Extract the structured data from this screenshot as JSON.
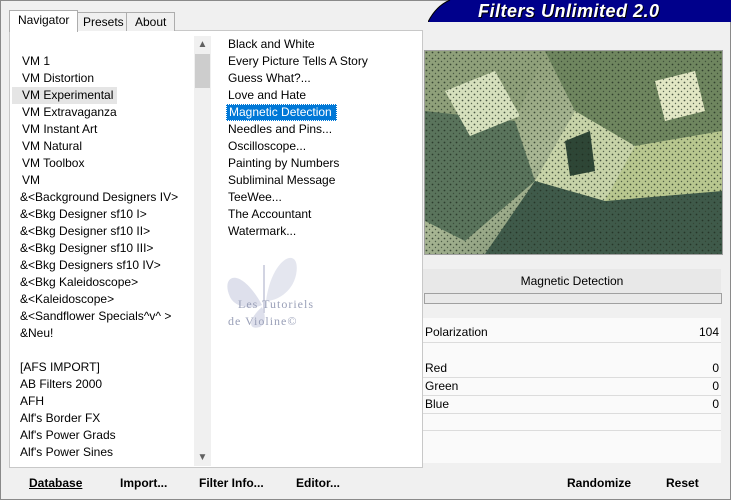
{
  "banner": {
    "title": "Filters Unlimited 2.0"
  },
  "tabs": [
    {
      "label": "Navigator",
      "active": true
    },
    {
      "label": "Presets",
      "active": false
    },
    {
      "label": "About",
      "active": false
    }
  ],
  "categories": {
    "items": [
      {
        "label": "VM 1"
      },
      {
        "label": "VM Distortion"
      },
      {
        "label": "VM Experimental",
        "selected": true
      },
      {
        "label": "VM Extravaganza"
      },
      {
        "label": "VM Instant Art"
      },
      {
        "label": "VM Natural"
      },
      {
        "label": "VM Toolbox"
      },
      {
        "label": "VM"
      },
      {
        "label": "&<Background Designers IV>"
      },
      {
        "label": "&<Bkg Designer sf10 I>"
      },
      {
        "label": "&<Bkg Designer sf10 II>"
      },
      {
        "label": "&<Bkg Designer sf10 III>"
      },
      {
        "label": "&<Bkg Designers sf10 IV>"
      },
      {
        "label": "&<Bkg Kaleidoscope>"
      },
      {
        "label": "&<Kaleidoscope>"
      },
      {
        "label": "&<Sandflower Specials^v^ >"
      },
      {
        "label": "&Neu!"
      },
      {
        "label": ""
      },
      {
        "label": "[AFS IMPORT]"
      },
      {
        "label": "AB Filters 2000"
      },
      {
        "label": "AFH"
      },
      {
        "label": "Alf's Border FX"
      },
      {
        "label": "Alf's Power Grads"
      },
      {
        "label": "Alf's Power Sines"
      }
    ]
  },
  "filters": {
    "items": [
      {
        "label": "Black and White"
      },
      {
        "label": "Every Picture Tells A Story"
      },
      {
        "label": "Guess  What?..."
      },
      {
        "label": "Love and Hate"
      },
      {
        "label": "Magnetic Detection",
        "selected": true
      },
      {
        "label": "Needles and Pins..."
      },
      {
        "label": "Oscilloscope..."
      },
      {
        "label": "Painting by Numbers"
      },
      {
        "label": "Subliminal Message"
      },
      {
        "label": "TeeWee..."
      },
      {
        "label": "The Accountant"
      },
      {
        "label": "Watermark..."
      }
    ]
  },
  "watermark": {
    "line1": "Les Tutoriels",
    "line2": "de Violine©"
  },
  "params": {
    "title": "Magnetic Detection",
    "rows": [
      {
        "label": "Polarization",
        "value": "104"
      },
      {
        "label": "Red",
        "value": "0"
      },
      {
        "label": "Green",
        "value": "0"
      },
      {
        "label": "Blue",
        "value": "0"
      }
    ]
  },
  "buttons": {
    "database": "Database",
    "import": "Import...",
    "filter_info": "Filter Info...",
    "editor": "Editor...",
    "randomize": "Randomize",
    "reset": "Reset"
  },
  "colors": {
    "banner": "#00008b",
    "selection": "#0078d7"
  }
}
